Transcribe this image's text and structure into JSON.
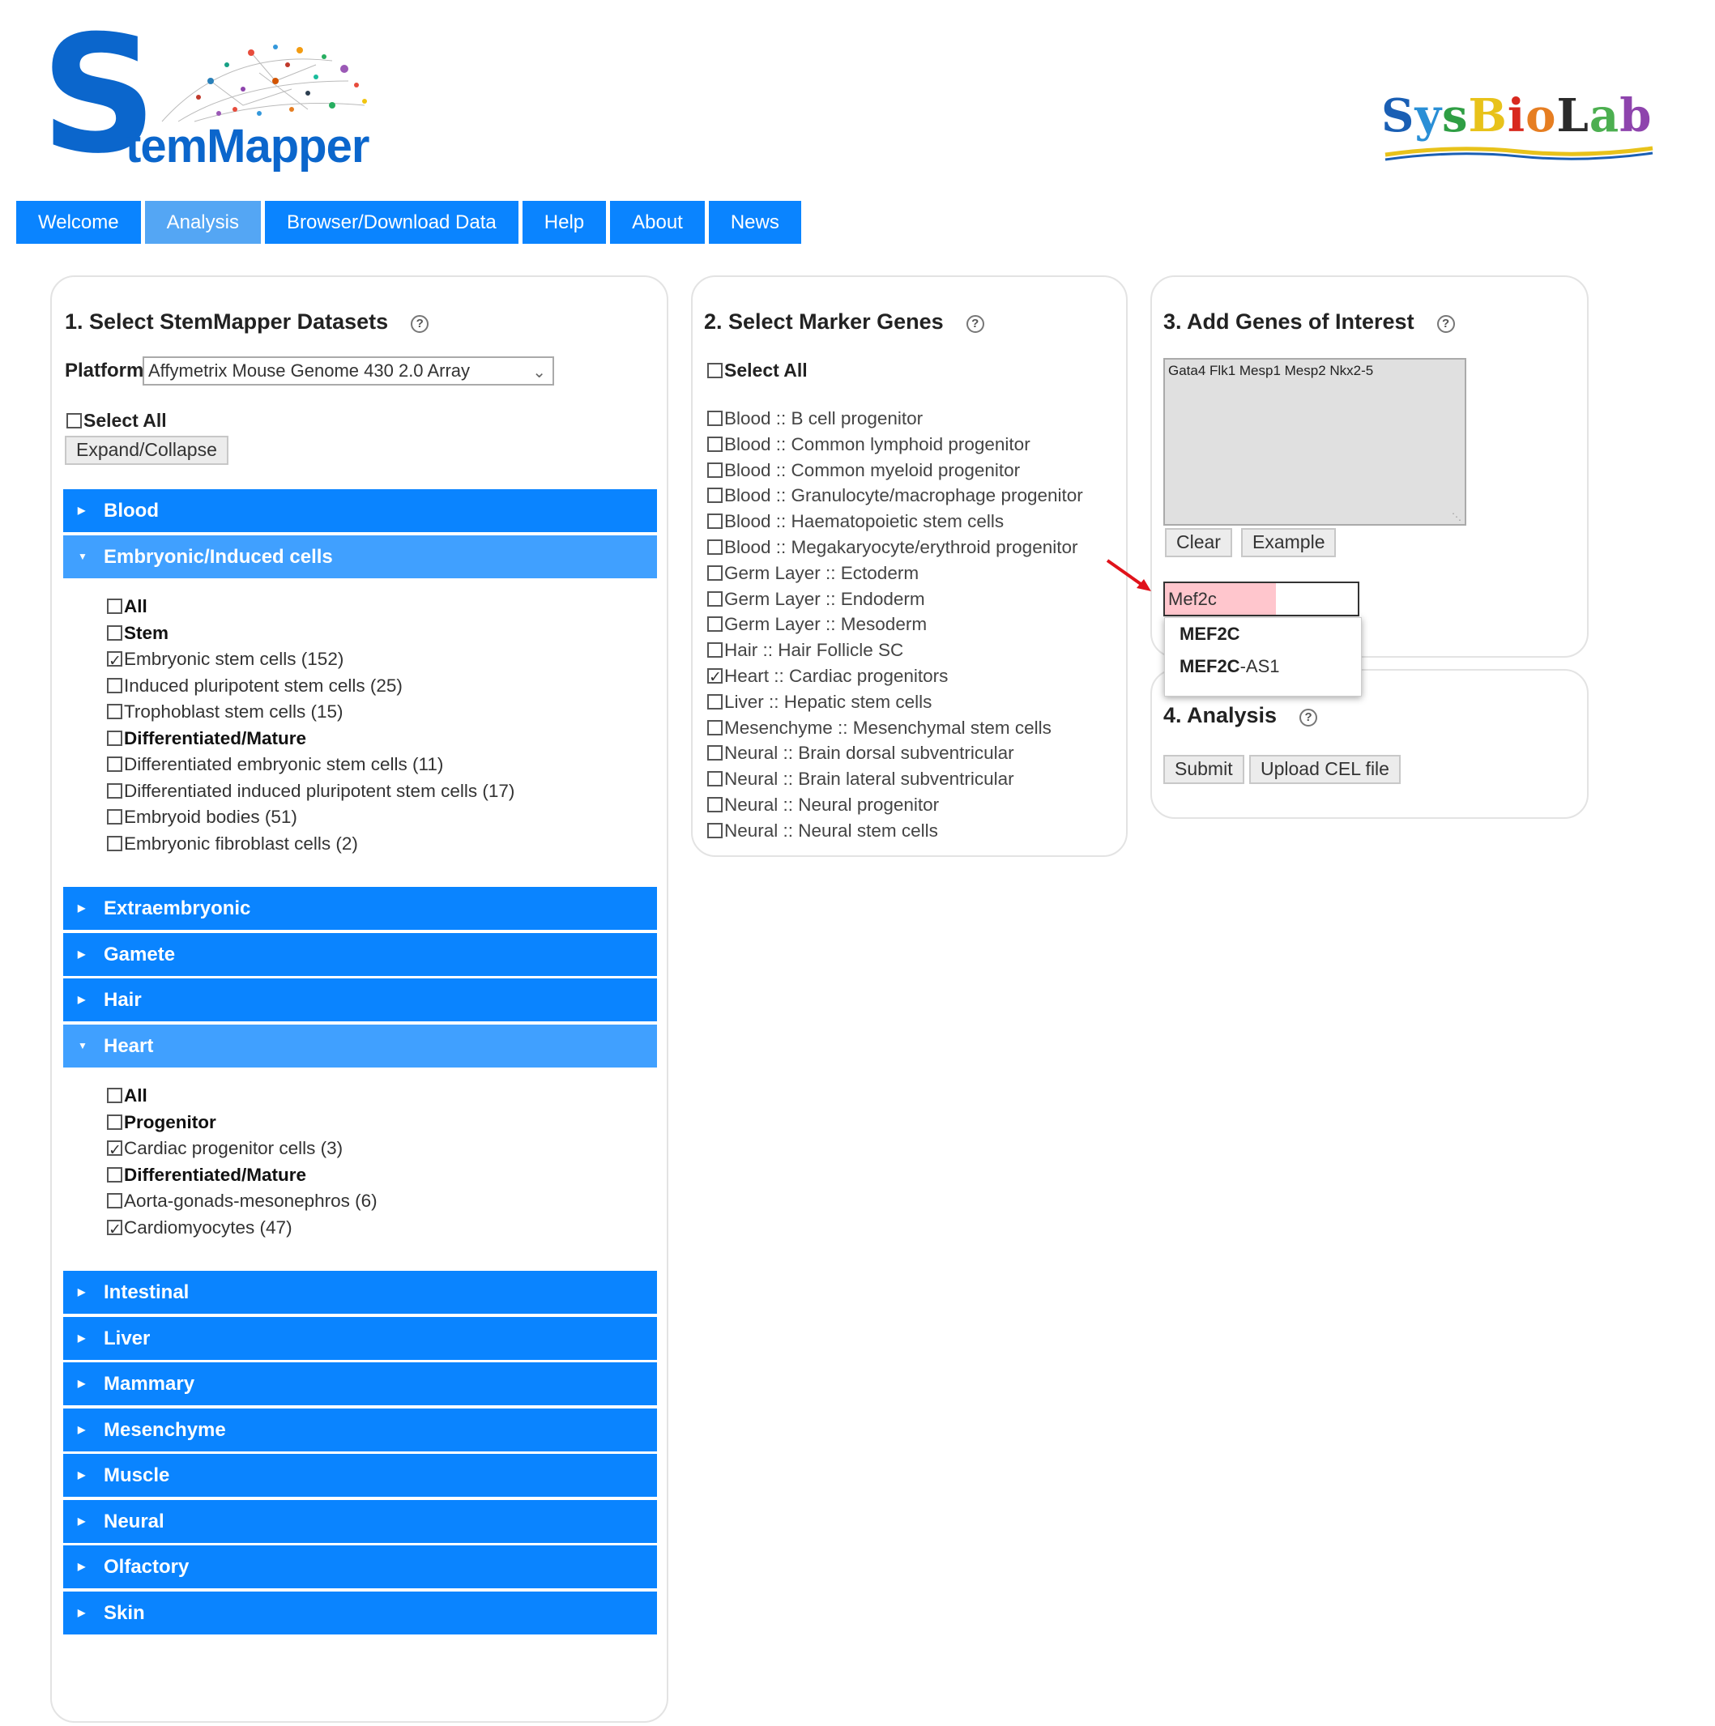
{
  "logo": {
    "big_letter": "S",
    "rest": "temMapper"
  },
  "sysbiolab": {
    "letters": [
      "S",
      "y",
      "s",
      "B",
      "i",
      "o",
      "L",
      "a",
      "b"
    ],
    "colors": [
      "#1a5fb4",
      "#2a8fd6",
      "#2f9e44",
      "#e8c21a",
      "#d8281e",
      "#e67e22",
      "#2b2b2b",
      "#4caf50",
      "#8e44ad"
    ]
  },
  "nav": {
    "items": [
      {
        "label": "Welcome",
        "active": false
      },
      {
        "label": "Analysis",
        "active": true
      },
      {
        "label": "Browser/Download Data",
        "active": false
      },
      {
        "label": "Help",
        "active": false
      },
      {
        "label": "About",
        "active": false
      },
      {
        "label": "News",
        "active": false
      }
    ]
  },
  "datasets": {
    "title": "1. Select StemMapper Datasets",
    "platform_label": "Platform:",
    "platform_value": "Affymetrix Mouse Genome 430 2.0 Array",
    "select_all": "Select All",
    "expand_collapse": "Expand/Collapse",
    "categories": [
      {
        "label": "Blood",
        "open": false
      },
      {
        "label": "Embryonic/Induced cells",
        "open": true
      },
      {
        "label": "Extraembryonic",
        "open": false
      },
      {
        "label": "Gamete",
        "open": false
      },
      {
        "label": "Hair",
        "open": false
      },
      {
        "label": "Heart",
        "open": true
      },
      {
        "label": "Intestinal",
        "open": false
      },
      {
        "label": "Liver",
        "open": false
      },
      {
        "label": "Mammary",
        "open": false
      },
      {
        "label": "Mesenchyme",
        "open": false
      },
      {
        "label": "Muscle",
        "open": false
      },
      {
        "label": "Neural",
        "open": false
      },
      {
        "label": "Olfactory",
        "open": false
      },
      {
        "label": "Skin",
        "open": false
      }
    ],
    "embryonic_items": [
      {
        "label": "All",
        "bold": true,
        "checked": false
      },
      {
        "label": "Stem",
        "bold": true,
        "checked": false
      },
      {
        "label": "Embryonic stem cells (152)",
        "bold": false,
        "checked": true
      },
      {
        "label": "Induced pluripotent stem cells (25)",
        "bold": false,
        "checked": false
      },
      {
        "label": "Trophoblast stem cells (15)",
        "bold": false,
        "checked": false
      },
      {
        "label": "Differentiated/Mature",
        "bold": true,
        "checked": false
      },
      {
        "label": "Differentiated embryonic stem cells (11)",
        "bold": false,
        "checked": false
      },
      {
        "label": "Differentiated induced pluripotent stem cells (17)",
        "bold": false,
        "checked": false
      },
      {
        "label": "Embryoid bodies (51)",
        "bold": false,
        "checked": false
      },
      {
        "label": "Embryonic fibroblast cells (2)",
        "bold": false,
        "checked": false
      }
    ],
    "heart_items": [
      {
        "label": "All",
        "bold": true,
        "checked": false
      },
      {
        "label": "Progenitor",
        "bold": true,
        "checked": false
      },
      {
        "label": "Cardiac progenitor cells (3)",
        "bold": false,
        "checked": true
      },
      {
        "label": "Differentiated/Mature",
        "bold": true,
        "checked": false
      },
      {
        "label": "Aorta-gonads-mesonephros (6)",
        "bold": false,
        "checked": false
      },
      {
        "label": "Cardiomyocytes (47)",
        "bold": false,
        "checked": true
      }
    ]
  },
  "markers": {
    "title": "2. Select Marker Genes",
    "select_all": "Select All",
    "items": [
      {
        "label": "Blood :: B cell progenitor",
        "checked": false
      },
      {
        "label": "Blood :: Common lymphoid progenitor",
        "checked": false
      },
      {
        "label": "Blood :: Common myeloid progenitor",
        "checked": false
      },
      {
        "label": "Blood :: Granulocyte/macrophage progenitor",
        "checked": false
      },
      {
        "label": "Blood :: Haematopoietic stem cells",
        "checked": false
      },
      {
        "label": "Blood :: Megakaryocyte/erythroid progenitor",
        "checked": false
      },
      {
        "label": "Germ Layer :: Ectoderm",
        "checked": false
      },
      {
        "label": "Germ Layer :: Endoderm",
        "checked": false
      },
      {
        "label": "Germ Layer :: Mesoderm",
        "checked": false
      },
      {
        "label": "Hair :: Hair Follicle SC",
        "checked": false
      },
      {
        "label": "Heart :: Cardiac progenitors",
        "checked": true
      },
      {
        "label": "Liver :: Hepatic stem cells",
        "checked": false
      },
      {
        "label": "Mesenchyme :: Mesenchymal stem cells",
        "checked": false
      },
      {
        "label": "Neural :: Brain dorsal subventricular",
        "checked": false
      },
      {
        "label": "Neural :: Brain lateral subventricular",
        "checked": false
      },
      {
        "label": "Neural :: Neural progenitor",
        "checked": false
      },
      {
        "label": "Neural :: Neural stem cells",
        "checked": false
      }
    ]
  },
  "genes": {
    "title": "3. Add Genes of Interest",
    "textarea_value": "Gata4 Flk1 Mesp1 Mesp2 Nkx2-5",
    "clear_label": "Clear",
    "example_label": "Example",
    "input_value": "Mef2c",
    "suggestions": [
      {
        "match": "MEF2C",
        "rest": ""
      },
      {
        "match": "MEF2C",
        "rest": "-AS1"
      }
    ]
  },
  "analysis": {
    "title": "4. Analysis",
    "submit_label": "Submit",
    "upload_label": "Upload CEL file"
  },
  "help_glyph": "?"
}
